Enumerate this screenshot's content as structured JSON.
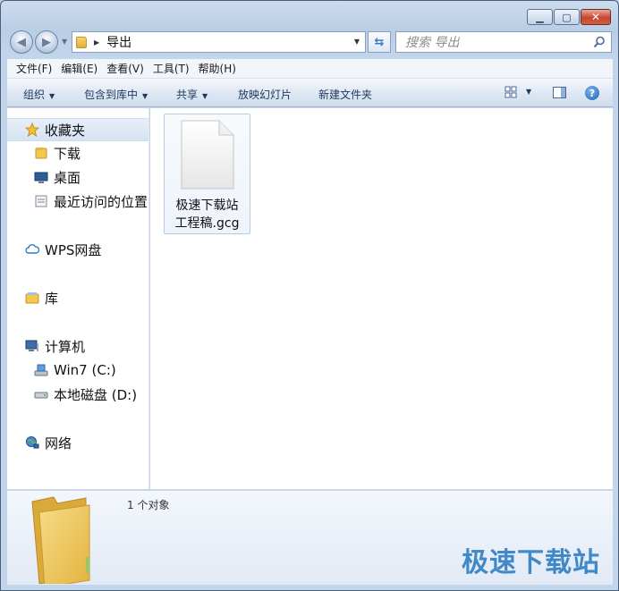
{
  "address": {
    "crumb": "导出"
  },
  "search": {
    "placeholder": "搜索 导出"
  },
  "menu": [
    "文件(F)",
    "编辑(E)",
    "查看(V)",
    "工具(T)",
    "帮助(H)"
  ],
  "commands": {
    "organize": "组织",
    "include": "包含到库中",
    "share": "共享",
    "slideshow": "放映幻灯片",
    "new_folder": "新建文件夹"
  },
  "nav": {
    "favorites": "收藏夹",
    "downloads": "下载",
    "desktop": "桌面",
    "recent": "最近访问的位置",
    "wps": "WPS网盘",
    "libraries": "库",
    "computer": "计算机",
    "drive_c": "Win7 (C:)",
    "drive_d": "本地磁盘 (D:)",
    "network": "网络"
  },
  "files": [
    {
      "name_line1": "极速下载站",
      "name_line2": "工程稿.gcg"
    }
  ],
  "status": {
    "count": "1 个对象"
  },
  "watermark": "极速下载站",
  "colors": {
    "accent": "#2f7fc4",
    "folder": "#f2c94c"
  }
}
